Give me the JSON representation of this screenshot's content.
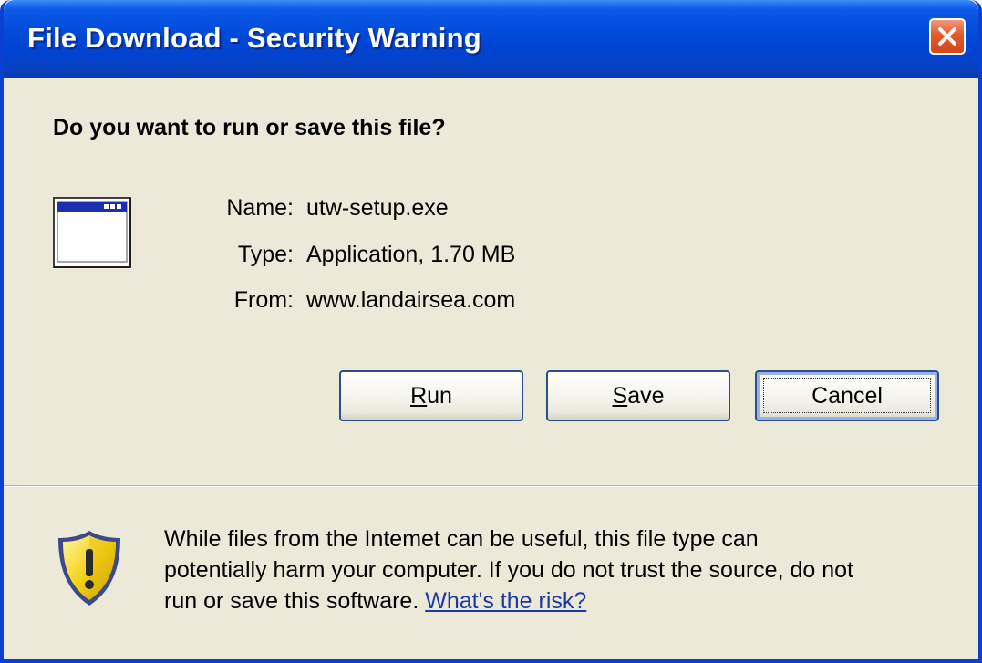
{
  "window": {
    "title": "File Download - Security Warning",
    "close_icon": "close-icon",
    "colors": {
      "titlebar": "#0049d8",
      "close": "#e25a2a",
      "background": "#ece9d8",
      "link": "#1a3aa8"
    }
  },
  "dialog": {
    "question": "Do you want to run or save this file?",
    "file_icon": "application-window-icon",
    "file": {
      "name_label": "Name:",
      "name_value": "utw-setup.exe",
      "type_label": "Type:",
      "type_value": "Application, 1.70 MB",
      "from_label": "From:",
      "from_value": "www.landairsea.com"
    },
    "buttons": {
      "run": {
        "label": "Run",
        "mnemonic": "R",
        "rest": "un"
      },
      "save": {
        "label": "Save",
        "mnemonic": "S",
        "rest": "ave"
      },
      "cancel": {
        "label": "Cancel"
      }
    }
  },
  "warning": {
    "icon": "shield-warning-icon",
    "line1": "While files from the Intemet can be useful, this file type can",
    "line2": "potentially harm your computer. If you do not trust the source, do not",
    "line3_text": "run or save this software. ",
    "link": "What's the risk?"
  }
}
